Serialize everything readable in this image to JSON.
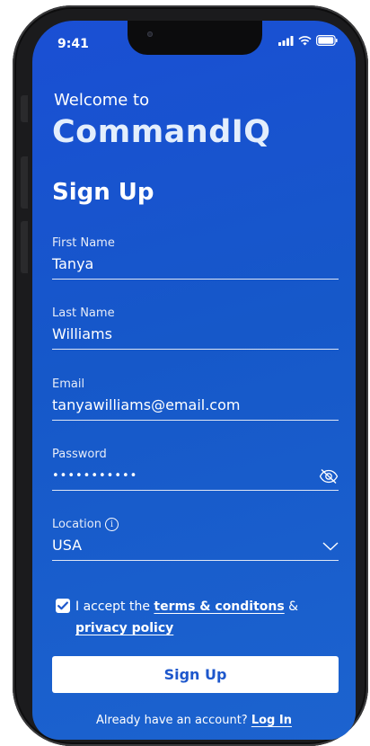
{
  "status_bar": {
    "time": "9:41"
  },
  "header": {
    "welcome": "Welcome to",
    "brand": "CommandIQ",
    "title": "Sign Up"
  },
  "form": {
    "first_name": {
      "label": "First Name",
      "value": "Tanya"
    },
    "last_name": {
      "label": "Last Name",
      "value": "Williams"
    },
    "email": {
      "label": "Email",
      "value": "tanyawilliams@email.com"
    },
    "password": {
      "label": "Password",
      "value": "•••••••••••"
    },
    "location": {
      "label": "Location",
      "value": "USA"
    }
  },
  "terms": {
    "checked": true,
    "prefix": "I accept the ",
    "terms_link": "terms & conditons",
    "joiner": " & ",
    "privacy_link": "privacy policy"
  },
  "actions": {
    "signup_label": "Sign Up",
    "login_prompt": "Already have an account? ",
    "login_link": "Log In"
  },
  "icons": {
    "info": "info-icon",
    "password_toggle": "eye-slash-icon",
    "dropdown": "chevron-down-icon",
    "checkbox": "check-icon"
  },
  "colors": {
    "background": "#1a56d0",
    "button_text": "#1d57cc",
    "brand_text": "#e3eefc"
  }
}
